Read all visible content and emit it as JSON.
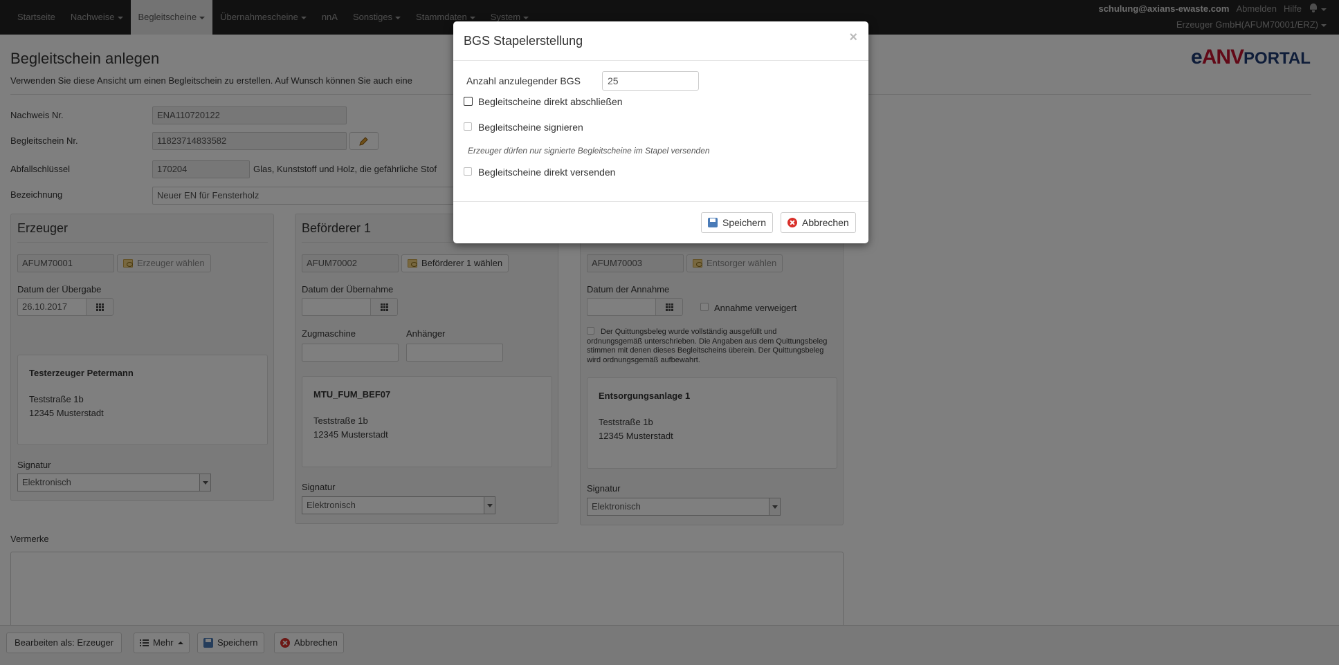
{
  "nav": {
    "items": [
      "Startseite",
      "Nachweise",
      "Begleitscheine",
      "Übernahmescheine",
      "nnA",
      "Sonstiges",
      "Stammdaten",
      "System"
    ],
    "user_email": "schulung@axians-ewaste.com",
    "logout": "Abmelden",
    "help": "Hilfe",
    "role": "Erzeuger GmbH(AFUM70001/ERZ)"
  },
  "page": {
    "title": "Begleitschein anlegen",
    "subtitle": "Verwenden Sie diese Ansicht um einen Begleitschein zu erstellen. Auf Wunsch können Sie auch eine",
    "logo_e": "e",
    "logo_anv": "ANV",
    "logo_portal": "PORTAL"
  },
  "form": {
    "nachweis_label": "Nachweis Nr.",
    "nachweis_value": "ENA110720122",
    "begleitschein_label": "Begleitschein Nr.",
    "begleitschein_value": "11823714833582",
    "abfall_label": "Abfallschlüssel",
    "abfall_value": "170204",
    "abfall_desc": "Glas, Kunststoff und Holz, die gefährliche Stof",
    "bezeichnung_label": "Bezeichnung",
    "bezeichnung_value": "Neuer EN für Fensterholz"
  },
  "erzeuger": {
    "title": "Erzeuger",
    "id": "AFUM70001",
    "choose": "Erzeuger wählen",
    "date_label": "Datum der Übergabe",
    "date_value": "26.10.2017",
    "name": "Testerzeuger Petermann",
    "street": "Teststraße 1b",
    "city": "12345 Musterstadt",
    "sig_label": "Signatur",
    "sig_value": "Elektronisch"
  },
  "befoerderer": {
    "title": "Beförderer 1",
    "id": "AFUM70002",
    "choose": "Beförderer 1 wählen",
    "date_label": "Datum der Übernahme",
    "zug_label": "Zugmaschine",
    "anh_label": "Anhänger",
    "name": "MTU_FUM_BEF07",
    "street": "Teststraße 1b",
    "city": "12345 Musterstadt",
    "sig_label": "Signatur",
    "sig_value": "Elektronisch"
  },
  "entsorger": {
    "id": "AFUM70003",
    "choose": "Entsorger wählen",
    "date_label": "Datum der Annahme",
    "refused": "Annahme verweigert",
    "quittung": "Der Quittungsbeleg wurde vollständig ausgefüllt und ordnungsgemäß unterschrieben. Die Angaben aus dem Quittungsbeleg stimmen mit denen dieses Begleitscheins überein. Der Quittungsbeleg wird ordnungsgemäß aufbewahrt.",
    "name": "Entsorgungsanlage 1",
    "street": "Teststraße 1b",
    "city": "12345 Musterstadt",
    "sig_label": "Signatur",
    "sig_value": "Elektronisch"
  },
  "vermerke_label": "Vermerke",
  "bottom": {
    "edit_as": "Bearbeiten als: Erzeuger",
    "more": "Mehr",
    "save": "Speichern",
    "cancel": "Abbrechen"
  },
  "modal": {
    "title": "BGS Stapelerstellung",
    "close": "×",
    "count_label": "Anzahl anzulegender BGS",
    "count_value": "25",
    "opt_close": "Begleitscheine direkt abschließen",
    "opt_sign": "Begleitscheine signieren",
    "hint": "Erzeuger dürfen nur signierte Begleitscheine im Stapel versenden",
    "opt_send": "Begleitscheine direkt versenden",
    "save": "Speichern",
    "cancel": "Abbrechen"
  }
}
